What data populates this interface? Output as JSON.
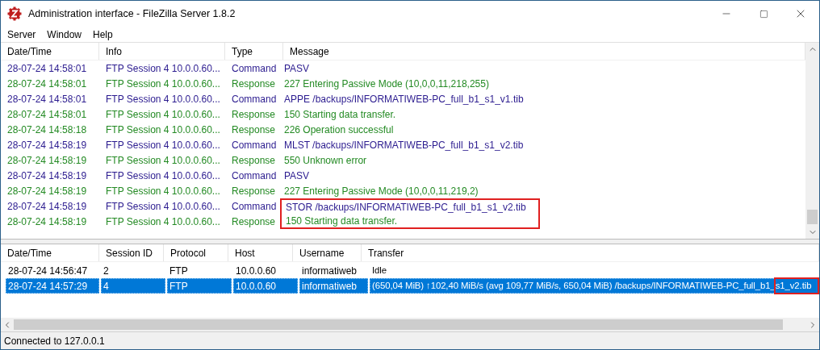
{
  "window": {
    "title": "Administration interface - FileZilla Server 1.8.2"
  },
  "menu": [
    "Server",
    "Window",
    "Help"
  ],
  "log": {
    "columns": [
      "Date/Time",
      "Info",
      "Type",
      "Message"
    ],
    "rows": [
      {
        "kind": "command",
        "date": "28-07-24 14:58:01",
        "info": "FTP Session 4 10.0.0.60...",
        "type": "Command",
        "message": "PASV",
        "highlighted": false
      },
      {
        "kind": "response",
        "date": "28-07-24 14:58:01",
        "info": "FTP Session 4 10.0.0.60...",
        "type": "Response",
        "message": "227 Entering Passive Mode (10,0,0,11,218,255)",
        "highlighted": false
      },
      {
        "kind": "command",
        "date": "28-07-24 14:58:01",
        "info": "FTP Session 4 10.0.0.60...",
        "type": "Command",
        "message": "APPE /backups/INFORMATIWEB-PC_full_b1_s1_v1.tib",
        "highlighted": false
      },
      {
        "kind": "response",
        "date": "28-07-24 14:58:01",
        "info": "FTP Session 4 10.0.0.60...",
        "type": "Response",
        "message": "150 Starting data transfer.",
        "highlighted": false
      },
      {
        "kind": "response",
        "date": "28-07-24 14:58:18",
        "info": "FTP Session 4 10.0.0.60...",
        "type": "Response",
        "message": "226 Operation successful",
        "highlighted": false
      },
      {
        "kind": "command",
        "date": "28-07-24 14:58:19",
        "info": "FTP Session 4 10.0.0.60...",
        "type": "Command",
        "message": "MLST /backups/INFORMATIWEB-PC_full_b1_s1_v2.tib",
        "highlighted": false
      },
      {
        "kind": "response",
        "date": "28-07-24 14:58:19",
        "info": "FTP Session 4 10.0.0.60...",
        "type": "Response",
        "message": "550 Unknown error",
        "highlighted": false
      },
      {
        "kind": "command",
        "date": "28-07-24 14:58:19",
        "info": "FTP Session 4 10.0.0.60...",
        "type": "Command",
        "message": "PASV",
        "highlighted": false
      },
      {
        "kind": "response",
        "date": "28-07-24 14:58:19",
        "info": "FTP Session 4 10.0.0.60...",
        "type": "Response",
        "message": "227 Entering Passive Mode (10,0,0,11,219,2)",
        "highlighted": false
      },
      {
        "kind": "command",
        "date": "28-07-24 14:58:19",
        "info": "FTP Session 4 10.0.0.60...",
        "type": "Command",
        "message": "STOR /backups/INFORMATIWEB-PC_full_b1_s1_v2.tib",
        "highlighted": true
      },
      {
        "kind": "response",
        "date": "28-07-24 14:58:19",
        "info": "FTP Session 4 10.0.0.60...",
        "type": "Response",
        "message": "150 Starting data transfer.",
        "highlighted": true
      }
    ]
  },
  "sessions": {
    "columns": [
      "Date/Time",
      "Session ID",
      "Protocol",
      "Host",
      "Username",
      "Transfer"
    ],
    "rows": [
      {
        "date": "28-07-24 14:56:47",
        "session_id": "2",
        "protocol": "FTP",
        "host": "10.0.0.60",
        "username": "informatiweb",
        "transfer": "Idle",
        "selected": false,
        "tail_highlighted": false
      },
      {
        "date": "28-07-24 14:57:29",
        "session_id": "4",
        "protocol": "FTP",
        "host": "10.0.0.60",
        "username": "informatiweb",
        "transfer": "(650,04 MiB) ↑102,40 MiB/s (avg 109,77 MiB/s, 650,04 MiB) /backups/INFORMATIWEB-PC_full_b1_s1_v2.tib",
        "selected": true,
        "tail_highlighted": true
      }
    ]
  },
  "status_bar": "Connected to 127.0.0.1"
}
